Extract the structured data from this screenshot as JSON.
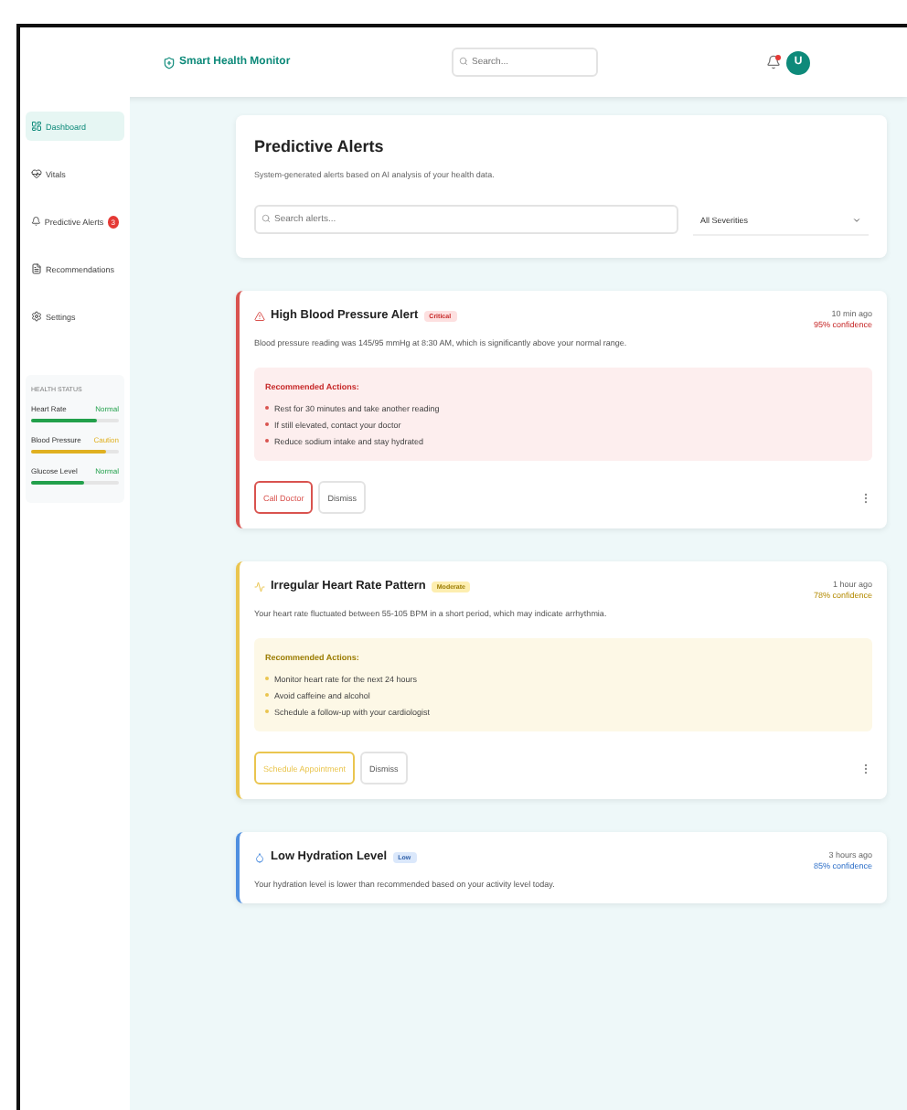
{
  "header": {
    "title": "Smart Health Monitor",
    "search": {
      "placeholder": "Search..."
    },
    "avatar": "U",
    "notification": true
  },
  "sidebar": {
    "items": [
      {
        "label": "Dashboard",
        "selected": true
      },
      {
        "label": "Vitals",
        "selected": false
      },
      {
        "label": "Predictive Alerts",
        "selected": false,
        "badge": "3"
      },
      {
        "label": "Recommendations",
        "selected": false
      },
      {
        "label": "Settings",
        "selected": false
      }
    ],
    "health_status": {
      "title": "HEALTH STATUS",
      "items": [
        {
          "name": "Heart Rate",
          "status": "Normal",
          "color": "#22a04b",
          "level": 0.75
        },
        {
          "name": "Blood Pressure",
          "status": "Caution",
          "color": "#e0b020",
          "level": 0.85
        },
        {
          "name": "Glucose Level",
          "status": "Normal",
          "color": "#22a04b",
          "level": 0.6
        }
      ]
    }
  },
  "page": {
    "title": "Predictive Alerts",
    "subtitle": "System-generated alerts based on AI analysis of your health data.",
    "search": {
      "placeholder": "Search alerts..."
    },
    "filter": "All Severities"
  },
  "alerts": [
    {
      "kind": "critical",
      "title": "High Blood Pressure Alert",
      "badge": "Critical",
      "time": "10 min ago",
      "confidence": "95% confidence",
      "description": "Blood pressure reading was 145/95 mmHg at 8:30 AM, which is significantly above your normal range.",
      "actions_title": "Recommended Actions:",
      "actions": [
        "Rest for 30 minutes and take another reading",
        "If still elevated, contact your doctor",
        "Reduce sodium intake and stay hydrated"
      ],
      "buttons": [
        "Call Doctor",
        "Dismiss"
      ]
    },
    {
      "kind": "moderate",
      "title": "Irregular Heart Rate Pattern",
      "badge": "Moderate",
      "time": "1 hour ago",
      "confidence": "78% confidence",
      "description": "Your heart rate fluctuated between 55-105 BPM in a short period, which may indicate arrhythmia.",
      "actions_title": "Recommended Actions:",
      "actions": [
        "Monitor heart rate for the next 24 hours",
        "Avoid caffeine and alcohol",
        "Schedule a follow-up with your cardiologist"
      ],
      "buttons": [
        "Schedule Appointment",
        "Dismiss"
      ]
    },
    {
      "kind": "low",
      "title": "Low Hydration Level",
      "badge": "Low",
      "time": "3 hours ago",
      "confidence": "85% confidence",
      "description": "Your hydration level is lower than recommended based on your activity level today."
    }
  ]
}
